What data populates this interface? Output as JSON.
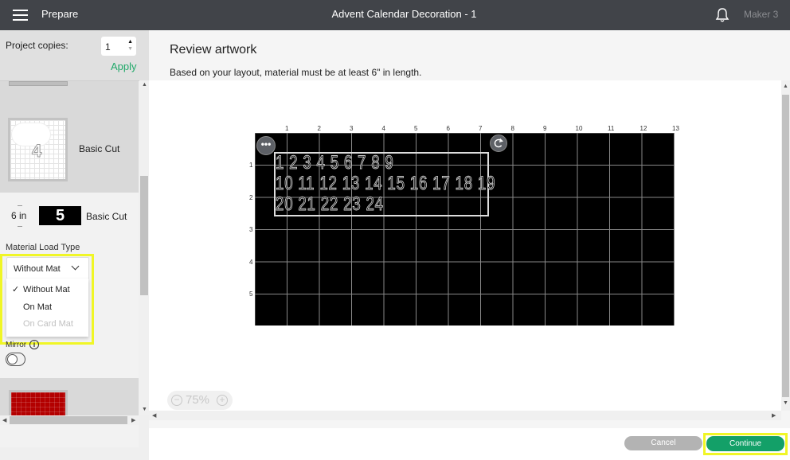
{
  "header": {
    "menu_icon": "hamburger-menu-icon",
    "section": "Prepare",
    "title": "Advent Calendar Decoration - 1",
    "bell_icon": "bell-icon",
    "machine": "Maker 3"
  },
  "sidebar": {
    "copies_label": "Project copies:",
    "copies_value": "1",
    "apply_label": "Apply",
    "mats": [
      {
        "number": "4",
        "cut_type": "Basic Cut",
        "color": "white"
      },
      {
        "number": "5",
        "size": "6 in",
        "cut_type": "Basic Cut",
        "color": "#000000"
      },
      {
        "color": "#b30000"
      }
    ],
    "material_load_type_label": "Material Load Type",
    "load_type_selected": "Without Mat",
    "load_type_options": [
      {
        "label": "Without Mat",
        "checked": true,
        "disabled": false
      },
      {
        "label": "On Mat",
        "checked": false,
        "disabled": false
      },
      {
        "label": "On Card Mat",
        "checked": false,
        "disabled": true
      }
    ],
    "mirror_label": "Mirror",
    "mirror_on": false
  },
  "main": {
    "title": "Review artwork",
    "subtitle": "Based on your layout, material must be at least 6\" in length.",
    "ruler_x": [
      "1",
      "2",
      "3",
      "4",
      "5",
      "6",
      "7",
      "8",
      "9",
      "10",
      "11",
      "12",
      "13"
    ],
    "ruler_y": [
      "1",
      "2",
      "3",
      "4",
      "5"
    ],
    "design_rows": [
      "1 2 3 4 5 6 7 8 9",
      "10 11 12 13 14 15 16 17 18 19",
      "20 21 22 23 24"
    ],
    "zoom_level": "75%",
    "mat_color": "#000000"
  },
  "footer": {
    "cancel_label": "Cancel",
    "continue_label": "Continue"
  },
  "colors": {
    "accent": "#13a068",
    "apply": "#21a96a",
    "highlight": "#f0f626",
    "header_bg": "#414449"
  }
}
